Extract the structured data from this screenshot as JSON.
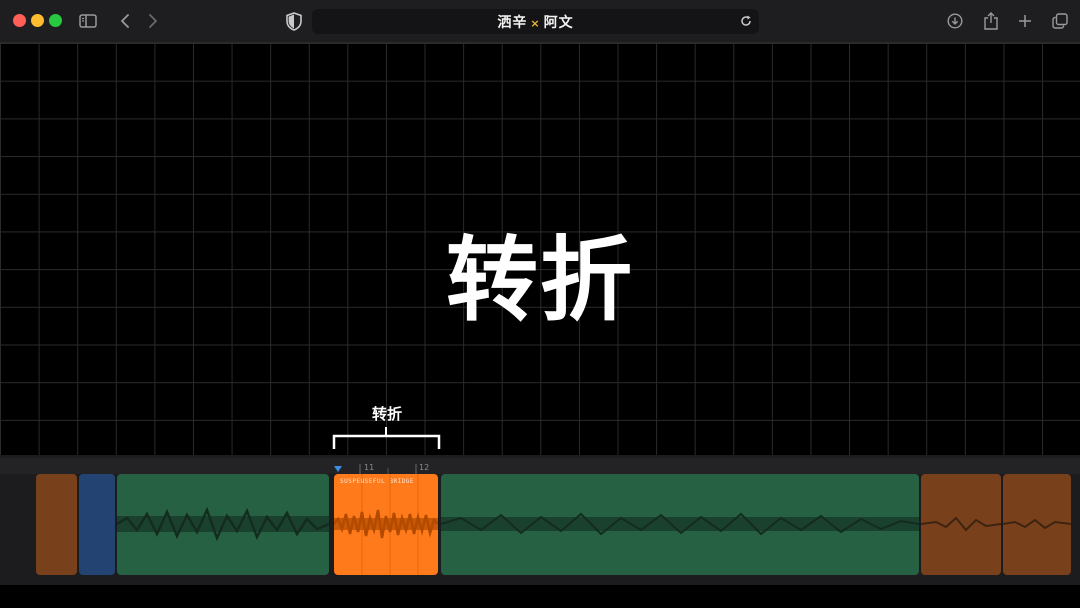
{
  "window": {
    "traffic_lights": [
      "#fe5f57",
      "#febc2e",
      "#28c840"
    ]
  },
  "toolbar": {
    "sidebar_icon": "sidebar-icon",
    "back_icon": "chevron-left-icon",
    "forward_icon": "chevron-right-icon",
    "shield_icon": "shield-icon",
    "reload_icon": "reload-icon",
    "download_icon": "download-icon",
    "share_icon": "share-icon",
    "new_tab_icon": "plus-icon",
    "tabs_icon": "tabs-overview-icon"
  },
  "address_bar": {
    "title_left": "洒辛",
    "title_sep": "×",
    "title_right": "阿文"
  },
  "canvas": {
    "title": "转折",
    "bracket_label": "转折"
  },
  "timeline": {
    "ruler_ticks": [
      "11",
      "12"
    ],
    "highlighted_region_name": "SUSPENSEFUL BRIDGE",
    "colors": {
      "orange": "#ff7a1a",
      "green": "#1f6e45",
      "blue": "#2a64b8",
      "track_bg": "#1c1c1e"
    }
  }
}
